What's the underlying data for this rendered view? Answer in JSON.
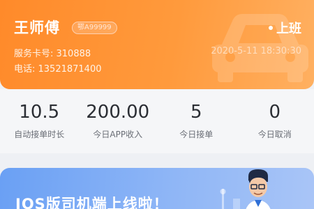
{
  "header": {
    "driver_name": "王师傅",
    "plate": "鄂A99999",
    "status": "上班",
    "card_label": "服务卡号: 310888",
    "phone_label": "电话: 13521871400",
    "timestamp": "2020-5-11 18:30:30"
  },
  "stats": [
    {
      "value": "10.5",
      "label": "自动接单时长"
    },
    {
      "value": "200.00",
      "label": "今日APP收入"
    },
    {
      "value": "5",
      "label": "今日接单"
    },
    {
      "value": "0",
      "label": "今日取消"
    }
  ],
  "banner": {
    "title": "IOS版司机端上线啦！"
  },
  "colors": {
    "header_gradient_start": "#ff8a2a",
    "header_gradient_end": "#ffb061",
    "banner_gradient_start": "#6aa0f4",
    "banner_gradient_end": "#a9c5f7"
  },
  "icons": [
    "car-watermark-icon",
    "status-dot-icon",
    "driver-illustration-icon"
  ]
}
